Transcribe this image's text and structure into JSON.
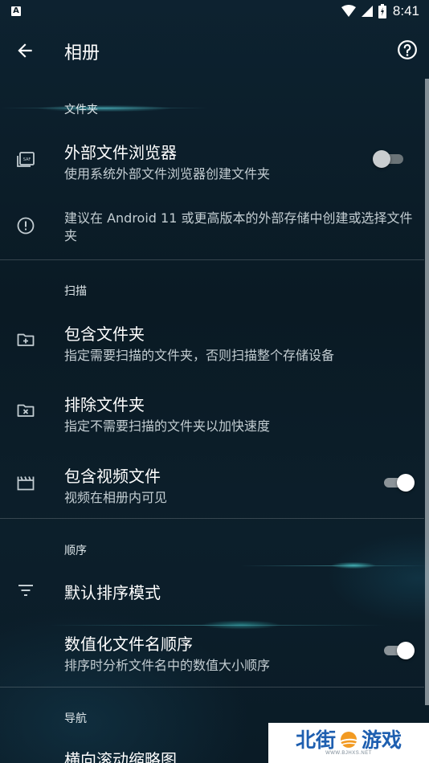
{
  "status_bar": {
    "time": "8:41",
    "left_badge": "A"
  },
  "app_bar": {
    "title": "相册"
  },
  "sections": {
    "folders": {
      "header": "文件夹",
      "external_browser": {
        "title": "外部文件浏览器",
        "subtitle": "使用系统外部文件浏览器创建文件夹",
        "enabled": false
      },
      "notice": {
        "text": "建议在 Android 11 或更高版本的外部存储中创建或选择文件夹"
      }
    },
    "scan": {
      "header": "扫描",
      "include_folders": {
        "title": "包含文件夹",
        "subtitle": "指定需要扫描的文件夹，否则扫描整个存储设备"
      },
      "exclude_folders": {
        "title": "排除文件夹",
        "subtitle": "指定不需要扫描的文件夹以加快速度"
      },
      "include_videos": {
        "title": "包含视频文件",
        "subtitle": "视频在相册内可见",
        "enabled": true
      }
    },
    "order": {
      "header": "顺序",
      "default_sort": {
        "title": "默认排序模式"
      },
      "numeric_names": {
        "title": "数值化文件名顺序",
        "subtitle": "排序时分析文件名中的数值大小顺序",
        "enabled": true
      }
    },
    "navigation": {
      "header": "导航",
      "horizontal_scroll": {
        "title": "横向滚动缩略图"
      }
    }
  },
  "watermark": {
    "part1": "北街",
    "part2": "游戏",
    "sub": "WWW.BJHXS.NET"
  },
  "colors": {
    "background": "#0b1c26",
    "accent_glow": "#5adce6",
    "text_secondary": "#c3cdd2"
  }
}
